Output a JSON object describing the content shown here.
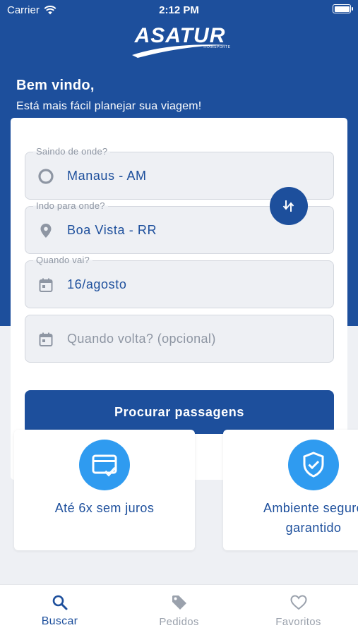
{
  "status_bar": {
    "carrier": "Carrier",
    "time": "2:12 PM"
  },
  "brand": {
    "logo_text": "ASATUR",
    "logo_subtext": "TRANSPORTE",
    "primary_color": "#1d4f9c",
    "accent_color": "#2f9bf0"
  },
  "welcome": {
    "title": "Bem vindo,",
    "subtitle": "Está mais fácil planejar sua viagem!"
  },
  "form": {
    "origin": {
      "label": "Saindo de onde?",
      "value": "Manaus - AM",
      "icon": "radio-circle-icon"
    },
    "destination": {
      "label": "Indo para onde?",
      "value": "Boa Vista - RR",
      "icon": "location-pin-icon"
    },
    "departure": {
      "label": "Quando vai?",
      "value": "16/agosto",
      "icon": "calendar-icon"
    },
    "return": {
      "placeholder": "Quando volta? (opcional)",
      "icon": "calendar-icon"
    },
    "swap_icon": "swap-arrows-icon",
    "search_button": "Procurar passagens"
  },
  "features": [
    {
      "text": "Até 6x sem juros",
      "icon": "card-check-icon"
    },
    {
      "line1": "Ambiente seguro",
      "line2": "garantido",
      "icon": "shield-check-icon"
    }
  ],
  "tabbar": {
    "tabs": [
      {
        "label": "Buscar",
        "icon": "search-icon",
        "active": true
      },
      {
        "label": "Pedidos",
        "icon": "tag-icon",
        "active": false
      },
      {
        "label": "Favoritos",
        "icon": "heart-icon",
        "active": false
      }
    ]
  }
}
